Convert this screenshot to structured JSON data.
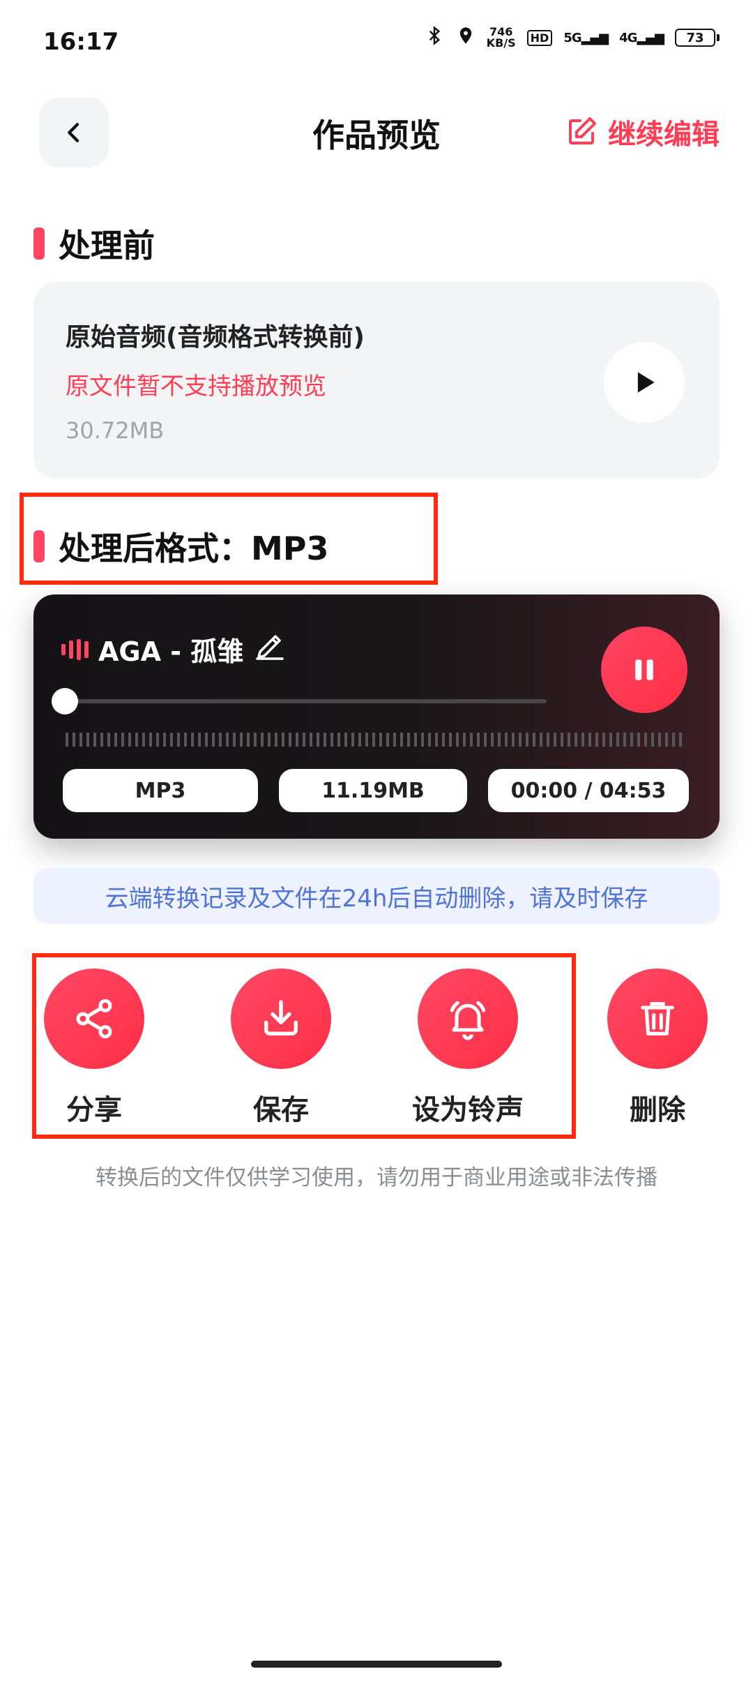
{
  "status_bar": {
    "time": "16:17",
    "net_speed_value": "746",
    "net_speed_unit": "KB/S",
    "hd": "HD",
    "sig1": "5G",
    "sig2": "4G",
    "battery": "73"
  },
  "header": {
    "title": "作品预览",
    "edit_label": "继续编辑"
  },
  "before": {
    "heading": "处理前",
    "card_title": "原始音频(音频格式转换前)",
    "note": "原文件暂不支持播放预览",
    "size": "30.72MB"
  },
  "after": {
    "heading": "处理后格式：MP3"
  },
  "player": {
    "track_name": "AGA - 孤雏",
    "progress": 0,
    "chips": {
      "format": "MP3",
      "size": "11.19MB",
      "time": "00:00 / 04:53"
    }
  },
  "notice": "云端转换记录及文件在24h后自动删除，请及时保存",
  "actions": {
    "share": "分享",
    "save": "保存",
    "ringtone": "设为铃声",
    "delete": "删除"
  },
  "disclaimer": "转换后的文件仅供学习使用，请勿用于商业用途或非法传播",
  "colors": {
    "accent": "#ff3d55",
    "highlight": "#ff2a10",
    "notice_text": "#4f73d6"
  }
}
